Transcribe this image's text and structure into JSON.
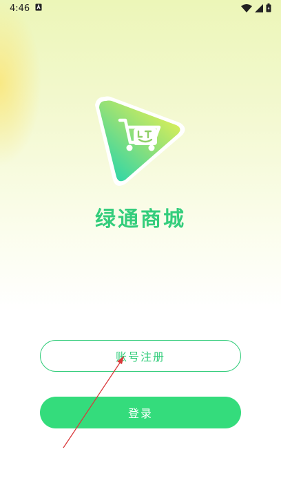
{
  "status_bar": {
    "time": "4:46",
    "icons": [
      "notification-a-icon",
      "wifi-icon",
      "signal-icon",
      "battery-icon"
    ]
  },
  "app": {
    "name": "绿通商城",
    "logo_icon": "cart-smile-logo-icon"
  },
  "buttons": {
    "register_label": "账号注册",
    "login_label": "登录"
  },
  "colors": {
    "brand_green": "#34cd7c",
    "button_green": "#34dc7c",
    "logo_gradient_start": "#2fd6a7",
    "logo_gradient_end": "#d8ee5a",
    "annotation_red": "#d9383a"
  }
}
